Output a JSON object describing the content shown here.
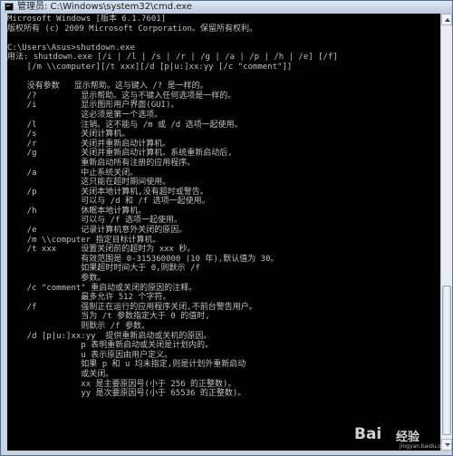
{
  "window": {
    "title": "管理员: C:\\Windows\\system32\\cmd.exe",
    "icon": "cmd-icon"
  },
  "console": {
    "lines": [
      "Microsoft Windows [版本 6.1.7601]",
      "版权所有 (c) 2009 Microsoft Corporation。保留所有权利。",
      "",
      "C:\\Users\\Asus>shutdown.exe",
      "用法: shutdown.exe [/i | /l | /s | /r | /g | /a | /p | /h | /e] [/f]",
      "    [/m \\\\computer][/t xxx][/d [p|u:]xx:yy [/c \"comment\"]]",
      "",
      "    没有参数   显示帮助。这与键入 /? 是一样的。",
      "    /?         显示帮助。这与不键入任何选项是一样的。",
      "    /i         显示图形用户界面(GUI)。",
      "               这必须是第一个选项。",
      "    /l         注销。这不能与 /m 或 /d 选项一起使用。",
      "    /s         关闭计算机。",
      "    /r         关闭并重新启动计算机。",
      "    /g         关闭并重新启动计算机。系统重新启动后,",
      "               重新启动所有注册的应用程序。",
      "    /a         中止系统关闭。",
      "               这只能在超时期间使用。",
      "    /p         关闭本地计算机,没有超时或警告。",
      "               可以与 /d 和 /f 选项一起使用。",
      "    /h         休眠本地计算机。",
      "               可以与 /f 选项一起使用。",
      "    /e         记录计算机意外关闭的原因。",
      "    /m \\\\computer 指定目标计算机。",
      "    /t xxx     设置关闭前的超时为 xxx 秒。",
      "               有效范围是 0-315360000 (10 年),默认值为 30。",
      "               如果超时时间大于 0,则默示 /f",
      "               参数。",
      "    /c \"comment\" 重启动或关闭的原因的注释。",
      "               最多允许 512 个字符。",
      "    /f         强制正在运行的应用程序关闭,不前台警告用户。",
      "               当为 /t 参数指定大于 0 的值时,",
      "               则默示 /f 参数。",
      "    /d [p|u:]xx:yy  提供重新启动或关机的原因。",
      "               p 表明重新启动或关闭是计划内的。",
      "               u 表示原因由用户定义。",
      "               如果 p 和 u 均未指定,则是计划外重新启动",
      "               或关闭。",
      "               xx 是主要原因号(小于 256 的正整数)。",
      "               yy 是次要原因号(小于 65536 的正整数)。"
    ]
  },
  "watermark": {
    "logo": "Bai",
    "sub": "经验",
    "url": "jingyan.baidu.com"
  }
}
